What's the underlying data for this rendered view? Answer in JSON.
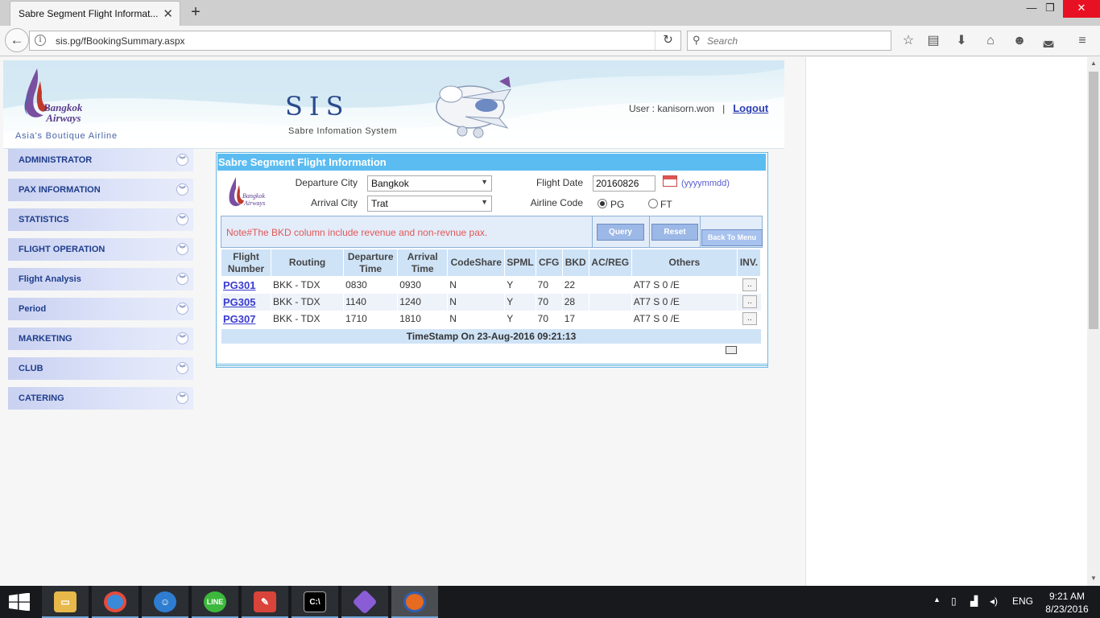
{
  "browser": {
    "tab_title": "Sabre Segment Flight Informat...",
    "url": "sis.pg/fBookingSummary.aspx",
    "search_placeholder": "Search"
  },
  "header": {
    "logo_name": "Bangkok Airways",
    "tagline": "Asia's Boutique Airline",
    "app_title": "SIS",
    "app_subtitle": "Sabre Infomation System",
    "user_label": "User : kanisorn.won",
    "separator": "|",
    "logout_label": "Logout"
  },
  "menu": [
    {
      "label": "ADMINISTRATOR"
    },
    {
      "label": "PAX INFORMATION"
    },
    {
      "label": "STATISTICS"
    },
    {
      "label": "FLIGHT OPERATION"
    },
    {
      "label": "Flight Analysis"
    },
    {
      "label": "Period"
    },
    {
      "label": "MARKETING"
    },
    {
      "label": "CLUB"
    },
    {
      "label": "CATERING"
    }
  ],
  "panel": {
    "title": "Sabre Segment Flight Information",
    "departure_label": "Departure City",
    "departure_value": "Bangkok",
    "arrival_label": "Arrival City",
    "arrival_value": "Trat",
    "flight_date_label": "Flight Date",
    "flight_date_value": "20160826",
    "date_format": "(yyyymmdd)",
    "airline_label": "Airline Code",
    "airline_options": [
      "PG",
      "FT"
    ],
    "airline_selected": "PG",
    "note": "Note#The BKD column include revenue and non-revnue pax.",
    "query_label": "Query",
    "reset_label": "Reset",
    "back_label": "Back To Menu",
    "columns": [
      "Flight Number",
      "Routing",
      "Departure Time",
      "Arrival Time",
      "CodeShare",
      "SPML",
      "CFG",
      "BKD",
      "AC/REG",
      "Others",
      "INV."
    ],
    "rows": [
      {
        "flight": "PG301",
        "routing": "BKK - TDX",
        "dep": "0830",
        "arr": "0930",
        "codeshare": "N",
        "spml": "Y",
        "cfg": "70",
        "bkd": "22",
        "acreg": "",
        "others": "AT7 S 0 /E",
        "inv": ".."
      },
      {
        "flight": "PG305",
        "routing": "BKK - TDX",
        "dep": "1140",
        "arr": "1240",
        "codeshare": "N",
        "spml": "Y",
        "cfg": "70",
        "bkd": "28",
        "acreg": "",
        "others": "AT7 S 0 /E",
        "inv": ".."
      },
      {
        "flight": "PG307",
        "routing": "BKK - TDX",
        "dep": "1710",
        "arr": "1810",
        "codeshare": "N",
        "spml": "Y",
        "cfg": "70",
        "bkd": "17",
        "acreg": "",
        "others": "AT7 S 0 /E",
        "inv": ".."
      }
    ],
    "timestamp": "TimeStamp On 23-Aug-2016 09:21:13"
  },
  "taskbar": {
    "apps": [
      "file-explorer",
      "chrome",
      "messenger",
      "line",
      "notes",
      "command-prompt",
      "app",
      "firefox"
    ],
    "lang": "ENG",
    "time": "9:21 AM",
    "date": "8/23/2016"
  },
  "colors": {
    "panel_title_bg": "#5bbcf1",
    "menu_text": "#1f3d8c",
    "note_text": "#e05858",
    "link": "#3a3ad0"
  }
}
